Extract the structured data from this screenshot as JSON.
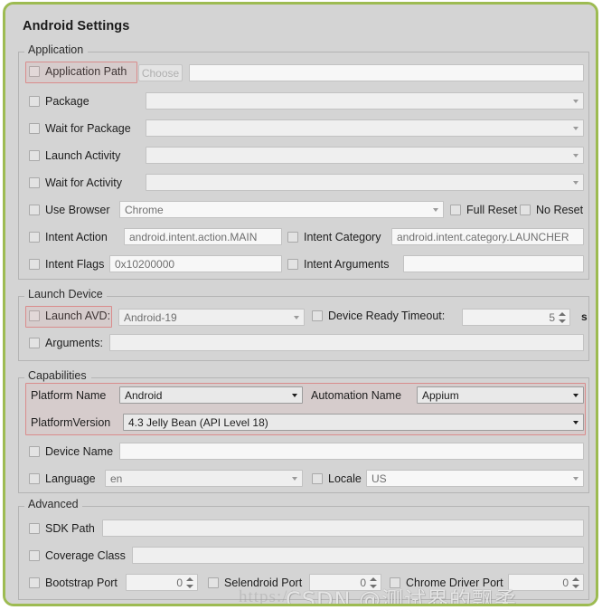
{
  "window": {
    "title": "Android Settings",
    "accent_green": "#9dbb52",
    "panel_bg": "#d4d4d4",
    "highlight_red": "#d98c8c"
  },
  "groups": {
    "application": {
      "label": "Application",
      "rows": {
        "application_path": {
          "label": "Application Path",
          "checked": false,
          "button": "Choose",
          "value": ""
        },
        "package": {
          "label": "Package",
          "checked": false,
          "value": ""
        },
        "wait_for_package": {
          "label": "Wait for Package",
          "checked": false,
          "value": ""
        },
        "launch_activity": {
          "label": "Launch Activity",
          "checked": false,
          "value": ""
        },
        "wait_for_activity": {
          "label": "Wait for Activity",
          "checked": false,
          "value": ""
        },
        "use_browser": {
          "label": "Use Browser",
          "checked": false,
          "value": "Chrome"
        },
        "full_reset": {
          "label": "Full Reset",
          "checked": false
        },
        "no_reset": {
          "label": "No Reset",
          "checked": false
        },
        "intent_action": {
          "label": "Intent Action",
          "checked": false,
          "value": "android.intent.action.MAIN"
        },
        "intent_category": {
          "label": "Intent Category",
          "checked": false,
          "value": "android.intent.category.LAUNCHER"
        },
        "intent_flags": {
          "label": "Intent Flags",
          "checked": false,
          "value": "0x10200000"
        },
        "intent_arguments": {
          "label": "Intent Arguments",
          "checked": false,
          "value": ""
        }
      }
    },
    "launch_device": {
      "label": "Launch Device",
      "rows": {
        "launch_avd": {
          "label": "Launch AVD:",
          "checked": false,
          "value": "Android-19"
        },
        "device_ready_timeout": {
          "label": "Device Ready Timeout:",
          "checked": false,
          "value": "5",
          "unit": "s"
        },
        "arguments": {
          "label": "Arguments:",
          "checked": false,
          "value": ""
        }
      }
    },
    "capabilities": {
      "label": "Capabilities",
      "rows": {
        "platform_name": {
          "label": "Platform Name",
          "value": "Android"
        },
        "automation_name": {
          "label": "Automation Name",
          "value": "Appium"
        },
        "platform_version": {
          "label": "PlatformVersion",
          "value": "4.3 Jelly Bean (API Level 18)"
        },
        "device_name": {
          "label": "Device Name",
          "checked": false,
          "value": ""
        },
        "language": {
          "label": "Language",
          "checked": false,
          "value": "en"
        },
        "locale": {
          "label": "Locale",
          "checked": false,
          "value": "US"
        }
      }
    },
    "advanced": {
      "label": "Advanced",
      "rows": {
        "sdk_path": {
          "label": "SDK Path",
          "checked": false,
          "value": ""
        },
        "coverage_class": {
          "label": "Coverage Class",
          "checked": false,
          "value": ""
        },
        "bootstrap_port": {
          "label": "Bootstrap Port",
          "checked": false,
          "value": "0"
        },
        "selendroid_port": {
          "label": "Selendroid Port",
          "checked": false,
          "value": "0"
        },
        "chrome_driver_port": {
          "label": "Chrome Driver Port",
          "checked": false,
          "value": "0"
        }
      }
    }
  },
  "watermark": {
    "url": "https://",
    "text": "CSDN @测试界的飘柔"
  }
}
